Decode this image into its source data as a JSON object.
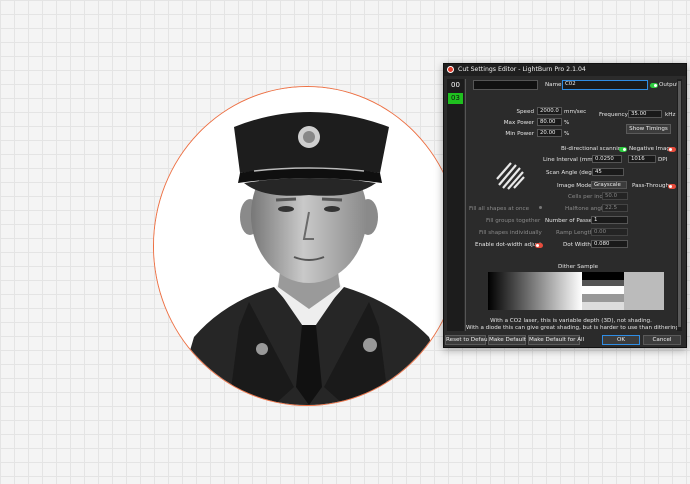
{
  "dialog": {
    "title": "Cut Settings Editor - LightBurn Pro 2.1.04",
    "layers": [
      "00",
      "03"
    ],
    "name_label": "Name",
    "name_value": "C02",
    "output_label": "Output",
    "speed": {
      "label": "Speed",
      "value": "2000.0",
      "unit": "mm/sec"
    },
    "max_power": {
      "label": "Max Power",
      "value": "80.00",
      "unit": "%"
    },
    "min_power": {
      "label": "Min Power",
      "value": "20.00",
      "unit": "%"
    },
    "frequency": {
      "label": "Frequency",
      "value": "35.00",
      "unit": "kHz"
    },
    "show_timings_label": "Show Timings",
    "bidirectional_label": "Bi-directional scanning",
    "negative_image_label": "Negative Image",
    "line_interval": {
      "label": "Line Interval (mm)",
      "value": "0.0250",
      "dpi": "1016",
      "dpi_unit": "DPI"
    },
    "scan_angle": {
      "label": "Scan Angle (deg)",
      "value": "45"
    },
    "image_mode": {
      "label": "Image Mode",
      "value": "Grayscale"
    },
    "pass_through_label": "Pass-Through",
    "cells_per_inch": {
      "label": "Cells per inch",
      "value": "50.0"
    },
    "fill_all_shapes_label": "Fill all shapes at once",
    "halftone_angle": {
      "label": "Halftone angle",
      "value": "22.5"
    },
    "fill_groups_label": "Fill groups together",
    "number_of_passes": {
      "label": "Number of Passes",
      "value": "1"
    },
    "fill_shapes_individually_label": "Fill shapes individually",
    "ramp_length": {
      "label": "Ramp Length",
      "value": "0.00"
    },
    "enable_dot_width_label": "Enable dot-width adjust",
    "dot_width": {
      "label": "Dot Width",
      "value": "0.080"
    },
    "dither_sample_label": "Dither Sample",
    "info_line1": "With a CO2 laser, this is variable depth (3D), not shading.",
    "info_line2": "With a diode this can give great shading, but is harder to use than dithering.",
    "buttons": {
      "reset": "Reset to Default",
      "make_default": "Make Default",
      "make_default_all": "Make Default for All",
      "ok": "OK",
      "cancel": "Cancel"
    },
    "toggles": {
      "output": true,
      "bidirectional": true,
      "negative_image": false,
      "pass_through": false,
      "dot_width_adjust": false
    },
    "colors": {
      "accent_green": "#1fc01f",
      "toggle_on": "#2ecc40",
      "toggle_off": "#e74c3c",
      "shape_outline": "#ee7043"
    }
  }
}
